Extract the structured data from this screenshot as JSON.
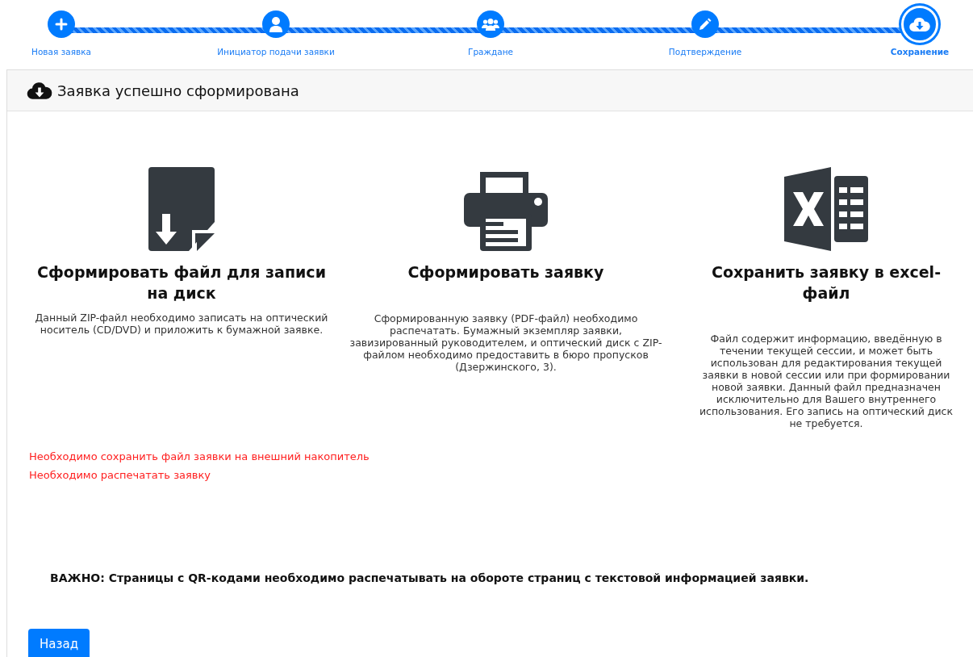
{
  "steps": [
    {
      "label": "Новая заявка",
      "kind": "plus",
      "selected": false
    },
    {
      "label": "Инициатор подачи заявки",
      "kind": "user",
      "selected": false
    },
    {
      "label": "Граждане",
      "kind": "users",
      "selected": false
    },
    {
      "label": "Подтверждение",
      "kind": "pencil",
      "selected": false
    },
    {
      "label": "Сохранение",
      "kind": "cloud",
      "selected": true
    }
  ],
  "card": {
    "title": "Заявка успешно сформирована",
    "options": [
      {
        "kind": "file",
        "title": "Сформировать файл для записи на диск",
        "text": "Данный ZIP-файл необходимо записать на оптический носитель (CD/DVD) и приложить к бумажной заявке."
      },
      {
        "kind": "printer",
        "title": "Сформировать заявку",
        "text": "Сформированную заявку (PDF-файл) необходимо распечатать. Бумажный экземпляр заявки, завизированный руководителем, и оптический диск с ZIP-файлом необходимо предоставить в бюро пропусков (Дзержинского, 3)."
      },
      {
        "kind": "excel",
        "title": "Сохранить заявку в excel-файл",
        "text": "Файл содержит информацию, введённую в течении текущей сессии, и может быть использован для редактирования текущей заявки в новой сессии или при формировании новой заявки. Данный файл предназначен исключительно для Вашего внутреннего использования. Его запись на оптический диск не требуется."
      }
    ],
    "warnings": [
      "Необходимо сохранить файл заявки на внешний накопитель",
      "Необходимо распечатать заявку"
    ],
    "notice": "ВАЖНО: Страницы с QR-кодами необходимо распечатывать на обороте страниц с текстовой информацией заявки.",
    "back_button": "Назад"
  }
}
